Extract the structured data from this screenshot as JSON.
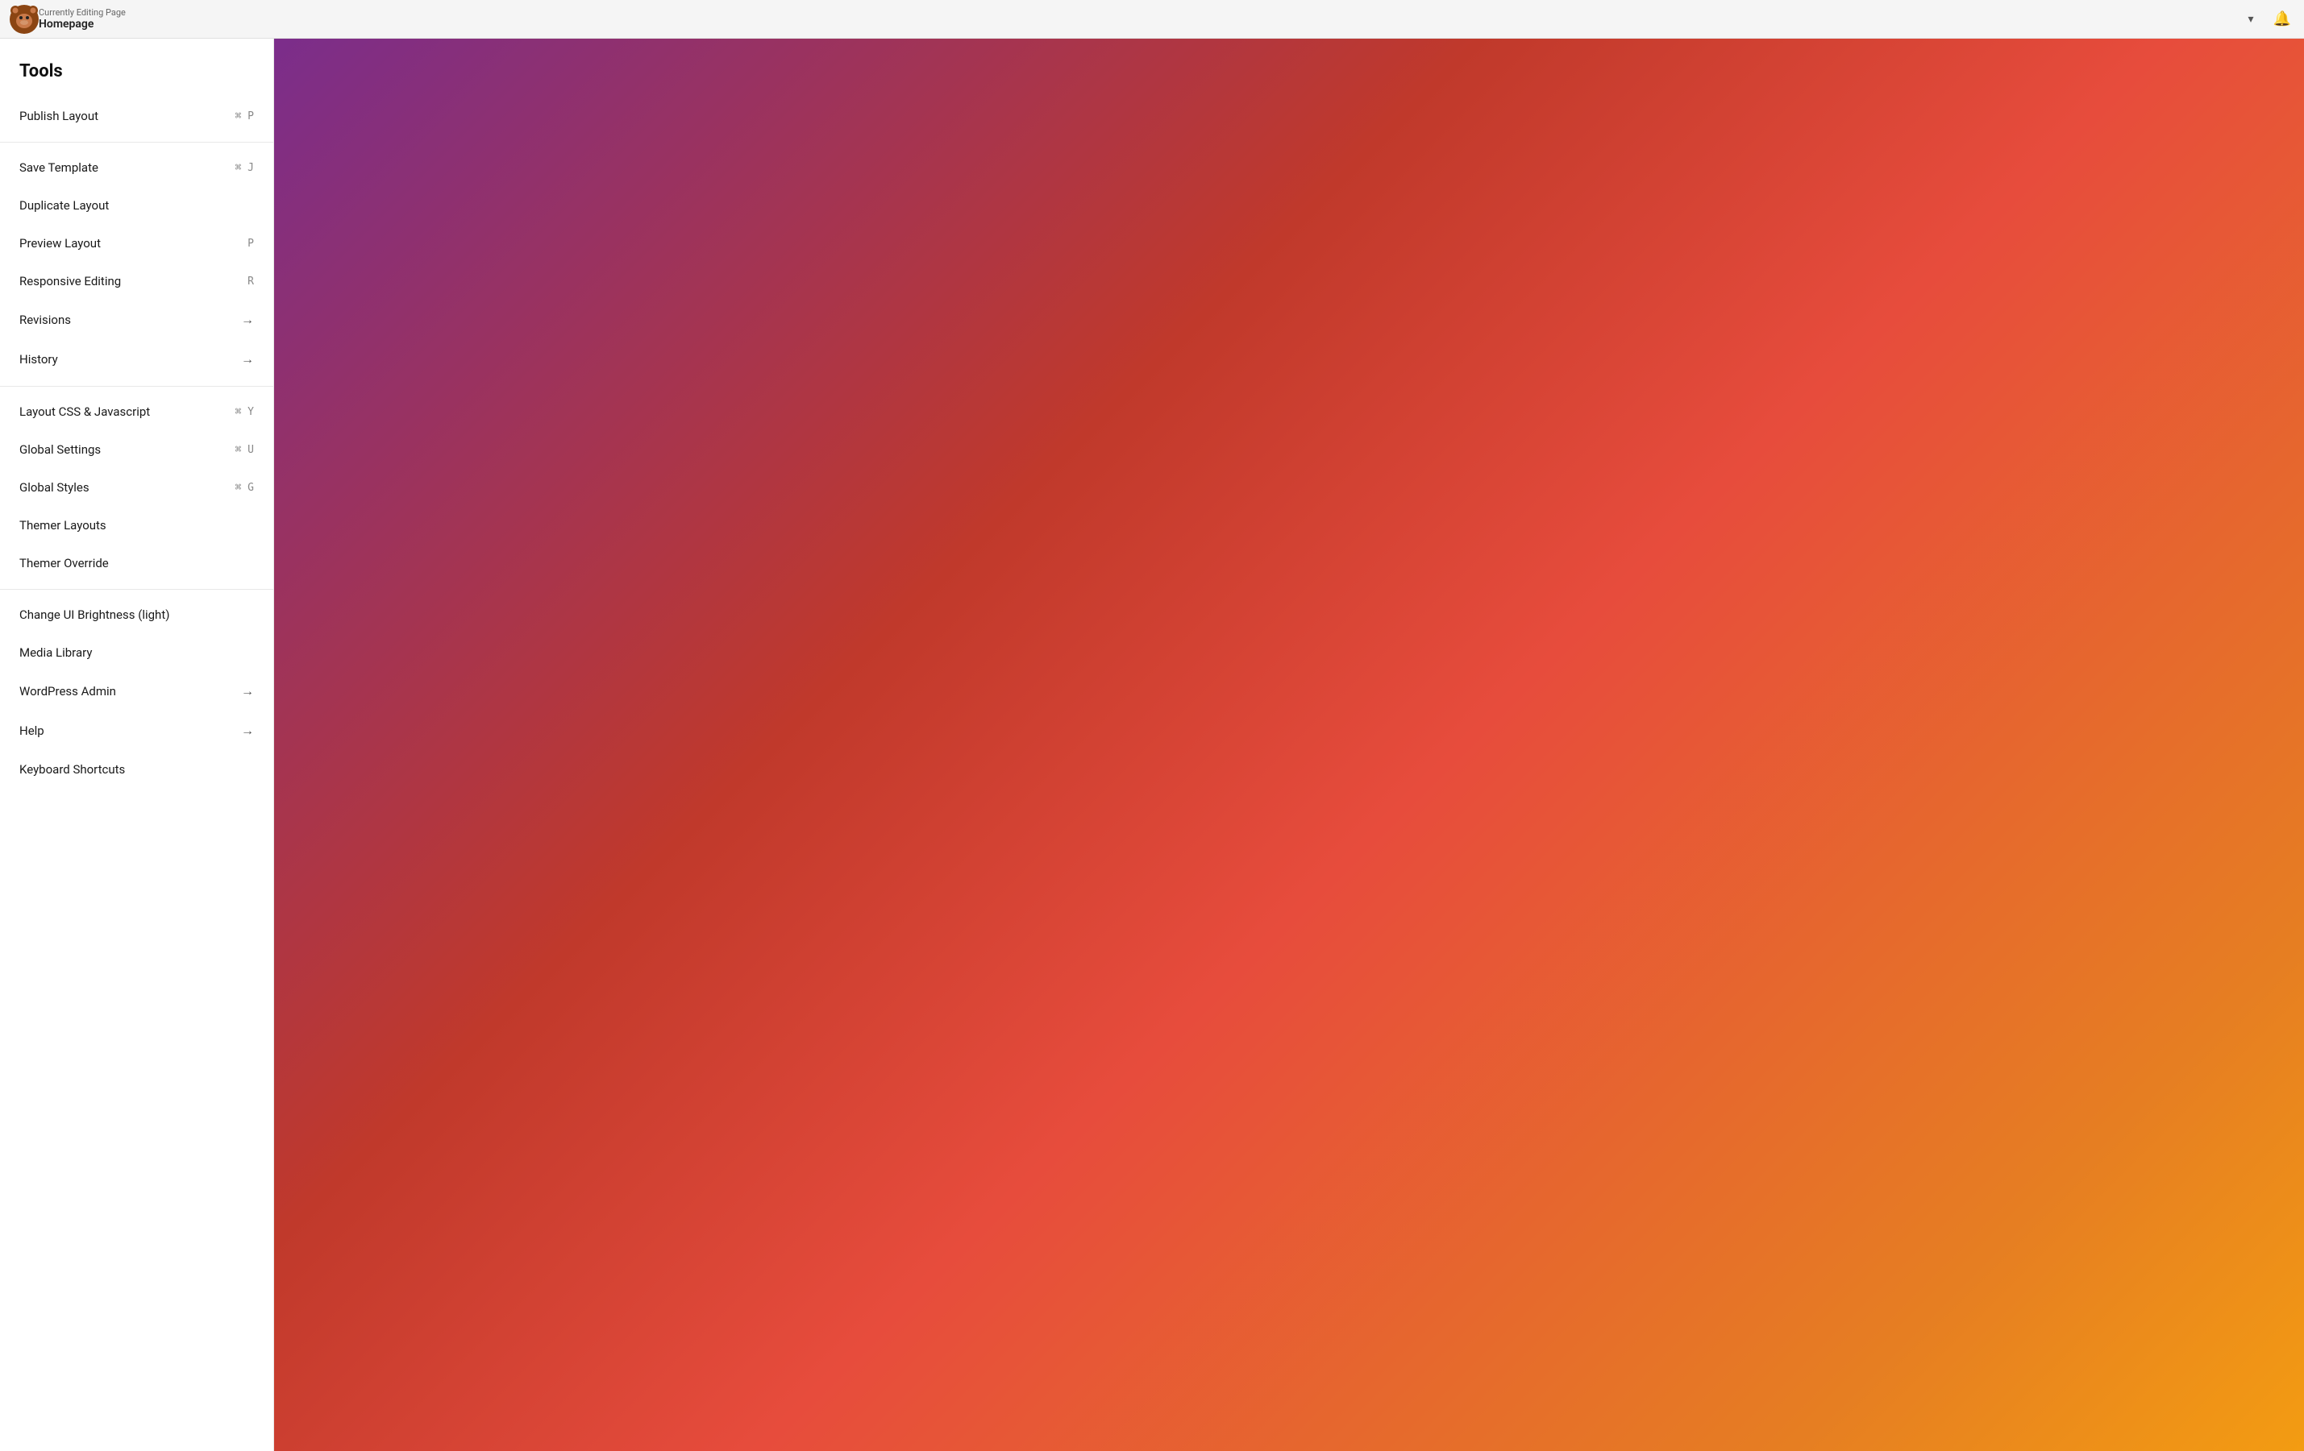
{
  "header": {
    "subtitle": "Currently Editing Page",
    "title": "Homepage",
    "chevron": "▾",
    "bell": "🔔"
  },
  "sidebar": {
    "section_title": "Tools",
    "groups": [
      {
        "items": [
          {
            "id": "publish-layout",
            "label": "Publish Layout",
            "shortcut": "⌘ P",
            "arrow": ""
          }
        ]
      },
      {
        "items": [
          {
            "id": "save-template",
            "label": "Save Template",
            "shortcut": "⌘ J",
            "arrow": ""
          },
          {
            "id": "duplicate-layout",
            "label": "Duplicate Layout",
            "shortcut": "",
            "arrow": ""
          },
          {
            "id": "preview-layout",
            "label": "Preview Layout",
            "shortcut": "P",
            "arrow": ""
          },
          {
            "id": "responsive-editing",
            "label": "Responsive Editing",
            "shortcut": "R",
            "arrow": ""
          },
          {
            "id": "revisions",
            "label": "Revisions",
            "shortcut": "",
            "arrow": "→"
          },
          {
            "id": "history",
            "label": "History",
            "shortcut": "",
            "arrow": "→"
          }
        ]
      },
      {
        "items": [
          {
            "id": "layout-css-js",
            "label": "Layout CSS & Javascript",
            "shortcut": "⌘ Y",
            "arrow": ""
          },
          {
            "id": "global-settings",
            "label": "Global Settings",
            "shortcut": "⌘ U",
            "arrow": ""
          },
          {
            "id": "global-styles",
            "label": "Global Styles",
            "shortcut": "⌘ G",
            "arrow": ""
          },
          {
            "id": "themer-layouts",
            "label": "Themer Layouts",
            "shortcut": "",
            "arrow": ""
          },
          {
            "id": "themer-override",
            "label": "Themer Override",
            "shortcut": "",
            "arrow": ""
          }
        ]
      },
      {
        "items": [
          {
            "id": "change-ui-brightness",
            "label": "Change UI Brightness (light)",
            "shortcut": "",
            "arrow": ""
          },
          {
            "id": "media-library",
            "label": "Media Library",
            "shortcut": "",
            "arrow": ""
          },
          {
            "id": "wordpress-admin",
            "label": "WordPress Admin",
            "shortcut": "",
            "arrow": "→"
          },
          {
            "id": "help",
            "label": "Help",
            "shortcut": "",
            "arrow": "→"
          },
          {
            "id": "keyboard-shortcuts",
            "label": "Keyboard Shortcuts",
            "shortcut": "",
            "arrow": ""
          }
        ]
      }
    ]
  }
}
